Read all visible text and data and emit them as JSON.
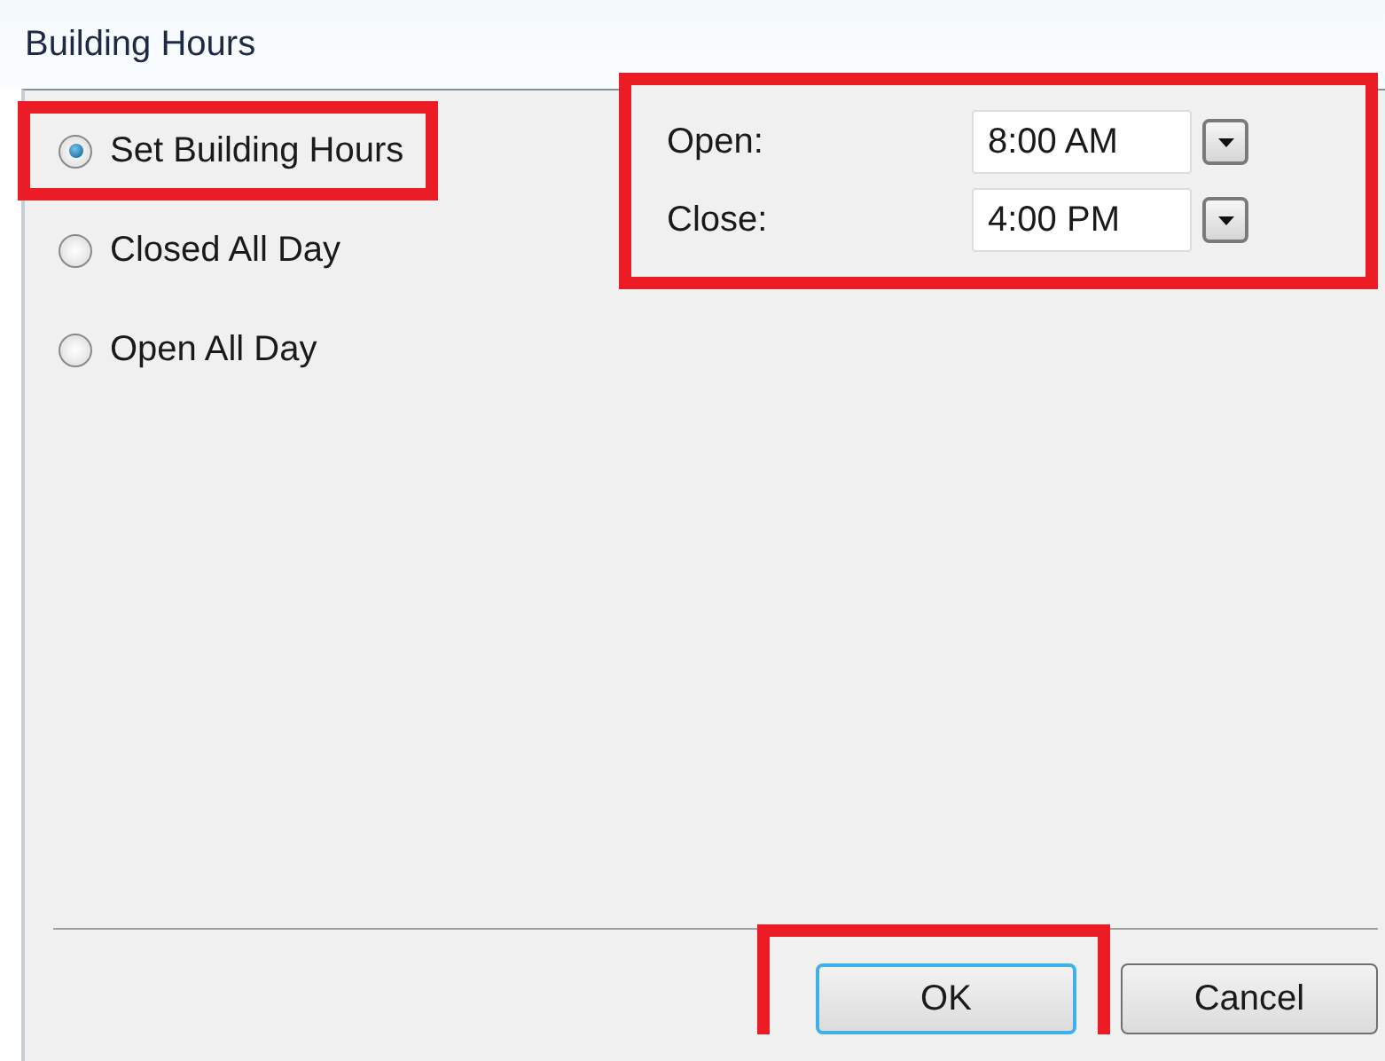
{
  "window": {
    "title": "Building Hours"
  },
  "options": [
    {
      "label": "Set Building Hours",
      "selected": true,
      "highlighted": true
    },
    {
      "label": "Closed All Day",
      "selected": false,
      "highlighted": false
    },
    {
      "label": "Open All Day",
      "selected": false,
      "highlighted": false
    }
  ],
  "time_panel": {
    "highlighted": true,
    "fields": [
      {
        "label": "Open:",
        "value": "8:00 AM"
      },
      {
        "label": "Close:",
        "value": "4:00 PM"
      }
    ]
  },
  "buttons": [
    {
      "label": "OK",
      "default": true,
      "highlighted": true
    },
    {
      "label": "Cancel",
      "default": false,
      "highlighted": false
    }
  ]
}
